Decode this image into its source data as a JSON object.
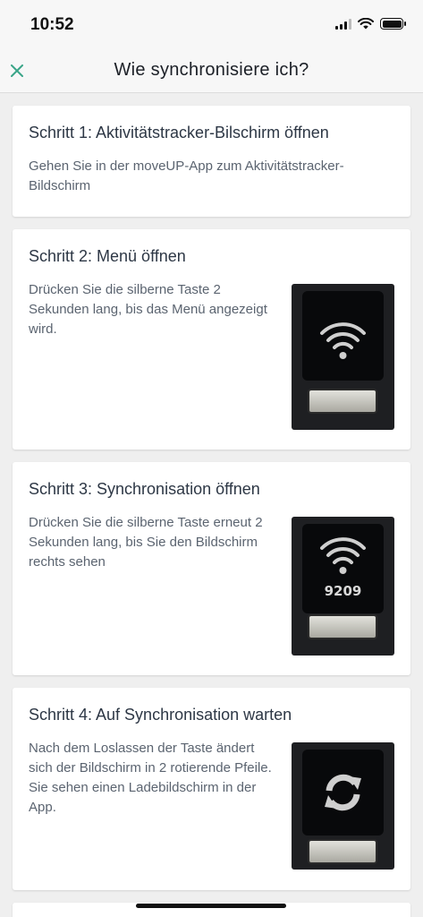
{
  "status": {
    "time": "10:52"
  },
  "nav": {
    "title": "Wie synchronisiere ich?",
    "close_icon": "close-icon"
  },
  "steps": [
    {
      "title": "Schritt 1: Aktivitätstracker-Bilschirm öffnen",
      "text": "Gehen Sie in der moveUP-App zum Aktivitätstracker-Bildschirm"
    },
    {
      "title": "Schritt 2: Menü öffnen",
      "text": "Drücken Sie die silberne Taste 2 Sekunden lang, bis das Menü angezeigt wird."
    },
    {
      "title": "Schritt 3: Synchronisation öffnen",
      "text": "Drücken Sie die silberne Taste erneut 2 Sekunden lang, bis Sie den Bildschirm rechts sehen",
      "device_number": "9209"
    },
    {
      "title": "Schritt 4: Auf Synchronisation warten",
      "text": "Nach dem Loslassen der Taste ändert sich der Bildschirm in 2 rotierende Pfeile. Sie sehen einen Ladebildschirm in der App."
    }
  ],
  "colors": {
    "accent": "#3aa588",
    "background": "#efefef",
    "card": "#ffffff"
  }
}
